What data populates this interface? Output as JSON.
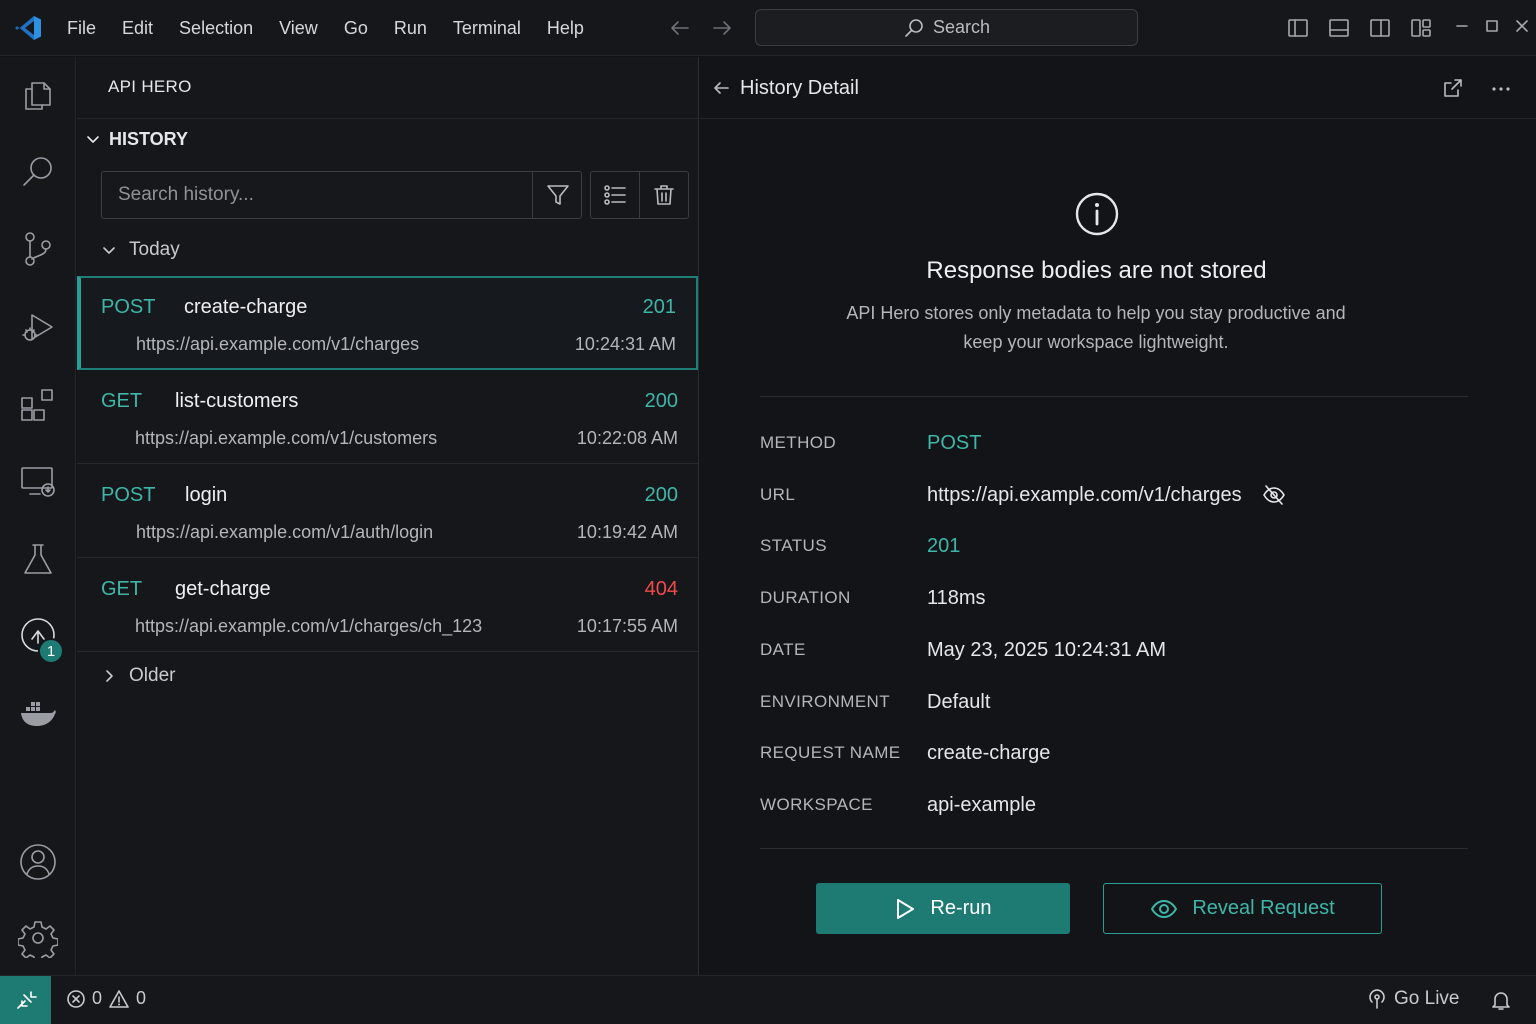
{
  "menu": [
    "File",
    "Edit",
    "Selection",
    "View",
    "Go",
    "Run",
    "Terminal",
    "Help"
  ],
  "search": {
    "label": "Search"
  },
  "colors": {
    "accent": "#1d7b74",
    "method": "#3fb6a8",
    "error": "#f04a4a"
  },
  "activity_icons": [
    "explorer-icon",
    "search-icon",
    "source-control-icon",
    "run-debug-icon",
    "extensions-icon",
    "remote-explorer-icon",
    "testing-icon",
    "api-hero-icon",
    "docker-icon",
    "accounts-icon",
    "settings-gear-icon"
  ],
  "activity_badge": "1",
  "sidebar": {
    "title": "API HERO",
    "section": "HISTORY",
    "search_placeholder": "Search history...",
    "group_today": "Today",
    "group_older": "Older",
    "items": [
      {
        "method": "POST",
        "name": "create-charge",
        "status": "201",
        "url": "https://api.example.com/v1/charges",
        "time": "10:24:31 AM"
      },
      {
        "method": "GET",
        "name": "list-customers",
        "status": "200",
        "url": "https://api.example.com/v1/customers",
        "time": "10:22:08 AM"
      },
      {
        "method": "POST",
        "name": "login",
        "status": "200",
        "url": "https://api.example.com/v1/auth/login",
        "time": "10:19:42 AM"
      },
      {
        "method": "GET",
        "name": "get-charge",
        "status": "404",
        "url": "https://api.example.com/v1/charges/ch_123",
        "time": "10:17:55 AM"
      }
    ]
  },
  "detail": {
    "title": "History Detail",
    "notice_title": "Response bodies are not stored",
    "notice_text": "API Hero stores only metadata to help you stay productive and keep your workspace lightweight.",
    "fields": {
      "method": {
        "label": "METHOD",
        "value": "POST"
      },
      "url": {
        "label": "URL",
        "value": "https://api.example.com/v1/charges"
      },
      "status": {
        "label": "STATUS",
        "value": "201"
      },
      "duration": {
        "label": "DURATION",
        "value": "118ms"
      },
      "date": {
        "label": "DATE",
        "value": "May 23, 2025 10:24:31 AM"
      },
      "environment": {
        "label": "ENVIRONMENT",
        "value": "Default"
      },
      "request_name": {
        "label": "REQUEST NAME",
        "value": "create-charge"
      },
      "workspace": {
        "label": "WORKSPACE",
        "value": "api-example"
      }
    },
    "rerun_label": "Re-run",
    "reveal_label": "Reveal Request"
  },
  "statusbar": {
    "errors": "0",
    "warnings": "0",
    "go_live": "Go Live"
  }
}
